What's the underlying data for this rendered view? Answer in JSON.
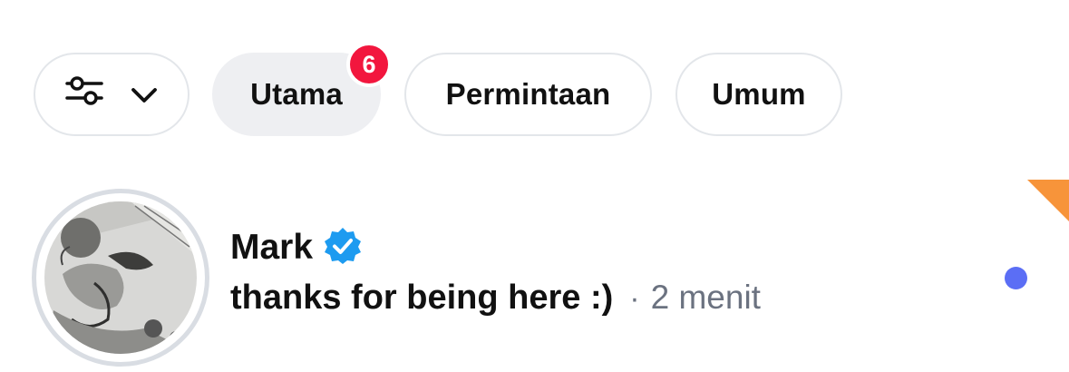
{
  "filters": {
    "tune_icon": "sliders-icon",
    "dropdown_icon": "chevron-down-icon",
    "tabs": [
      {
        "label": "Utama",
        "active": true,
        "badge": "6"
      },
      {
        "label": "Permintaan",
        "active": false
      },
      {
        "label": "Umum",
        "active": false
      }
    ]
  },
  "conversation": {
    "name": "Mark",
    "verified_icon": "verified-badge-icon",
    "message": "thanks for being here :)",
    "separator": "·",
    "time": "2 menit",
    "unread": true
  },
  "colors": {
    "badge": "#f2163e",
    "verified": "#1d9bf0",
    "unread_dot": "#5b6ef5",
    "corner_flag": "#f7943a",
    "active_chip": "#eeeff2",
    "secondary_text": "#6b7280"
  }
}
